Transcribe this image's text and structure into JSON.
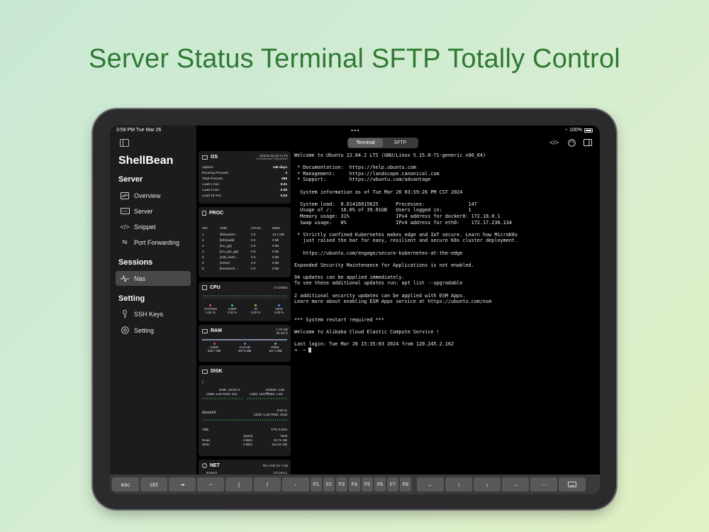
{
  "headline": "Server Status Terminal SFTP Totally Control",
  "status": {
    "time": "3:59 PM   Tue Mar 26",
    "battery": "100%"
  },
  "sidebar": {
    "title": "ShellBean",
    "sections": [
      {
        "title": "Server",
        "items": [
          {
            "label": "Overview",
            "icon": "chart-icon"
          },
          {
            "label": "Server",
            "icon": "server-icon"
          },
          {
            "label": "Snippet",
            "icon": "code-icon"
          },
          {
            "label": "Port Forwarding",
            "icon": "arrows-icon"
          }
        ]
      },
      {
        "title": "Sessions",
        "items": [
          {
            "label": "Nas",
            "icon": "activity-icon",
            "active": true
          }
        ]
      },
      {
        "title": "Setting",
        "items": [
          {
            "label": "SSH Keys",
            "icon": "key-icon"
          },
          {
            "label": "Setting",
            "icon": "gear-icon"
          }
        ]
      }
    ]
  },
  "toolbar": {
    "dots": "•••",
    "tabs": [
      "Terminal",
      "SFTP"
    ],
    "selected": "Terminal"
  },
  "os": {
    "title": "OS",
    "name": "Ubuntu 22.04.2 LTS",
    "id": "1222eebcea677ff5yokk2a2",
    "rows": [
      [
        "Uptime:",
        "140 days"
      ],
      [
        "Running Process:",
        "3"
      ],
      [
        "Total Process:",
        "286"
      ],
      [
        "Load 1 min:",
        "0.01"
      ],
      [
        "Load 5 min:",
        "0.05"
      ],
      [
        "Load 15 min:",
        "0.04"
      ]
    ]
  },
  "proc": {
    "title": "PROC",
    "headers": [
      "PID",
      "CMD",
      "CPU%",
      "MEM"
    ],
    "rows": [
      [
        "1",
        "/lib/system...",
        "0.0",
        "12.1 MB"
      ],
      [
        "2",
        "[kthreadd]",
        "0.0",
        "0 kB"
      ],
      [
        "3",
        "[rcu_gp]",
        "0.0",
        "0 kB"
      ],
      [
        "4",
        "[rcu_par_gp]",
        "0.0",
        "0 kB"
      ],
      [
        "5",
        "[slub_flush...",
        "0.0",
        "0 kB"
      ],
      [
        "6",
        "[netns]",
        "0.0",
        "0 kB"
      ],
      [
        "8",
        "[kworker/0:...",
        "0.0",
        "0 kB"
      ]
    ]
  },
  "cpu": {
    "title": "CPU",
    "cores": "2 CORES",
    "legend": [
      {
        "label": "SYSTEM",
        "value": "0.51 %",
        "color": "#e05050"
      },
      {
        "label": "USER",
        "value": "0.51 %",
        "color": "#5ac85a"
      },
      {
        "label": "IO",
        "value": "0.00 %",
        "color": "#e09a40"
      },
      {
        "label": "NICE",
        "value": "0.00 %",
        "color": "#4a8ee0"
      }
    ]
  },
  "ram": {
    "title": "RAM",
    "total": "1.73 GB",
    "percent": "35.18 %",
    "legend": [
      {
        "label": "USED",
        "value": "560.7 MB",
        "color": "#e05050"
      },
      {
        "label": "CACHE",
        "value": "957.5 MB",
        "color": "#4a8ee0"
      },
      {
        "label": "FREE",
        "value": "157.2 MB",
        "color": "#5ac85a"
      }
    ]
  },
  "disk": {
    "title": "DISK",
    "root": {
      "mount": "/",
      "size": "SIZE: 18.00 %",
      "inode": "INODE: 4.00 %",
      "used": "USED: 6.59 FREE: 31G",
      "iused": "USED: 181K FREE: 2.4M"
    },
    "efi": {
      "mount": "/boot/efi",
      "pct": "6.00 %",
      "used": "USED: 6.1M FREE: 101M"
    },
    "vda": {
      "name": "vda",
      "tps": "TPS 0.00/s",
      "speed": "Speed",
      "total": "Total",
      "read": "Read",
      "read_speed": "0 kB/s",
      "read_total": "13.71 GB",
      "write": "Write",
      "write_speed": "0 kB/s",
      "write_total": "112.44 GB"
    }
  },
  "net": {
    "title": "NET",
    "rates": "RX 3 KB   TX 7 KB",
    "iface": "docker0",
    "ip": "172.18.0.1"
  },
  "terminal": {
    "lines": [
      "Welcome to Ubuntu 22.04.2 LTS (GNU/Linux 5.15.0-71-generic x86_64)",
      "",
      " * Documentation:  https://help.ubuntu.com",
      " * Management:     https://landscape.canonical.com",
      " * Support:        https://ubuntu.com/advantage",
      "",
      "  System information as of Tue Mar 26 03:59:26 PM CST 2024",
      "",
      "  System load:  0.01416015625      Processes:               147",
      "  Usage of /:   16.6% of 39.01GB   Users logged in:         1",
      "  Memory usage: 31%                IPv4 address for docker0: 172.18.0.1",
      "  Swap usage:   0%                 IPv4 address for eth0:    172.17.236.134",
      "",
      " * Strictly confined Kubernetes makes edge and IoT secure. Learn how MicroK8s",
      "   just raised the bar for easy, resilient and secure K8s cluster deployment.",
      "",
      "   https://ubuntu.com/engage/secure-kubernetes-at-the-edge",
      "",
      "Expanded Security Maintenance for Applications is not enabled.",
      "",
      "94 updates can be applied immediately.",
      "To see these additional updates run: apt list --upgradable",
      "",
      "2 additional security updates can be applied with ESM Apps.",
      "Learn more about enabling ESM Apps service at https://ubuntu.com/esm",
      "",
      "",
      "*** System restart required ***",
      "",
      "Welcome to Alibaba Cloud Elastic Compute Service !",
      "",
      "Last login: Tue Mar 26 15:35:03 2024 from 120.245.2.162",
      "➜  ~ "
    ]
  },
  "keys": {
    "main": [
      "esc",
      "ctrl",
      "⇥",
      "~",
      "|",
      "/",
      "-"
    ],
    "fkeys": [
      "F1",
      "F2",
      "F3",
      "F4",
      "F5",
      "F6",
      "F7",
      "F8"
    ],
    "arrows": [
      "←",
      "↑",
      "↓",
      "→",
      "···"
    ]
  }
}
